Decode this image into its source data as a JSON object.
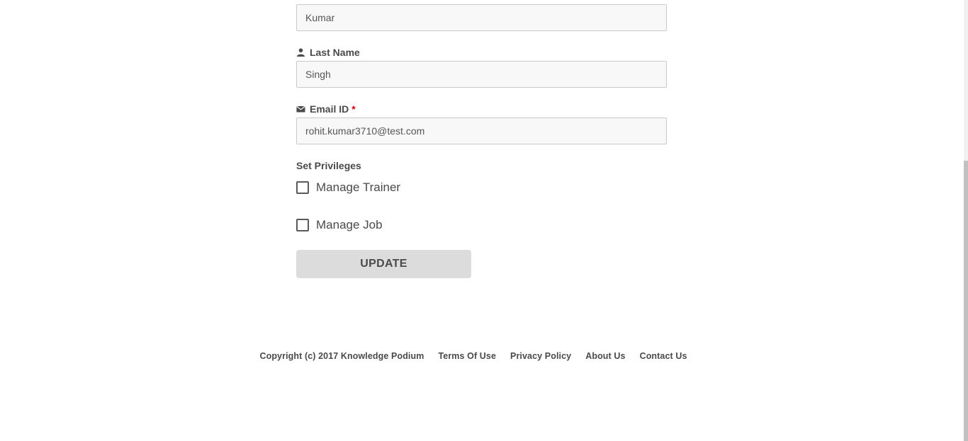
{
  "form": {
    "first_name": {
      "value": "Kumar"
    },
    "last_name": {
      "label": "Last Name",
      "value": "Singh",
      "icon": "user-icon"
    },
    "email": {
      "label": "Email ID",
      "required_mark": "*",
      "value": "rohit.kumar3710@test.com",
      "icon": "envelope-icon"
    },
    "privileges": {
      "title": "Set Privileges",
      "options": [
        {
          "label": "Manage Trainer",
          "checked": false
        },
        {
          "label": "Manage Job",
          "checked": false
        }
      ]
    },
    "update_label": "UPDATE"
  },
  "footer": {
    "copyright": "Copyright (c) 2017 Knowledge Podium",
    "links": [
      "Terms Of Use",
      "Privacy Policy",
      "About Us",
      "Contact Us"
    ]
  },
  "colors": {
    "required": "#d0021b",
    "button_bg": "#dddcdc",
    "input_bg": "#f8f8f8"
  }
}
